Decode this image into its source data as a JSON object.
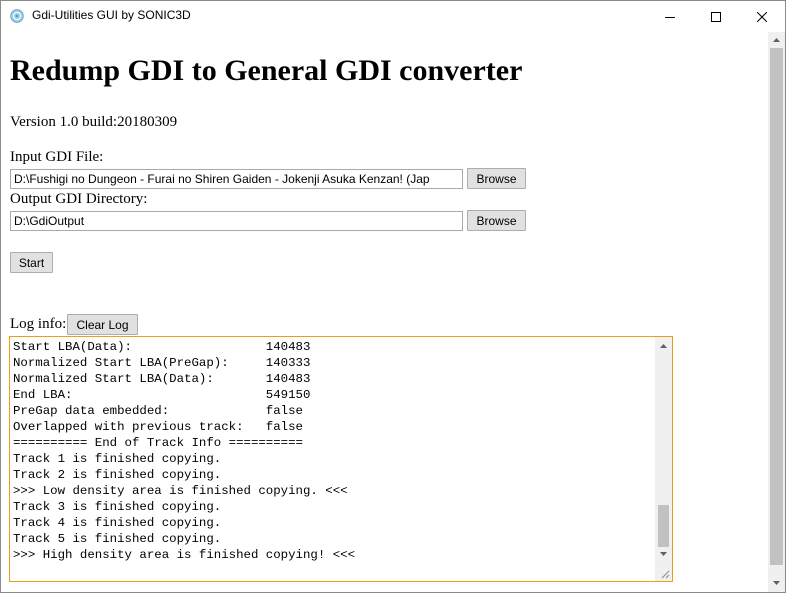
{
  "window": {
    "title": "Gdi-Utilities GUI by SONIC3D"
  },
  "header": {
    "title": "Redump GDI to General GDI converter",
    "version": "Version 1.0 build:20180309"
  },
  "form": {
    "input_label": "Input GDI File:",
    "input_value": "D:\\Fushigi no Dungeon - Furai no Shiren Gaiden - Jokenji Asuka Kenzan! (Jap",
    "browse_label": "Browse",
    "output_label": "Output GDI Directory:",
    "output_value": "D:\\GdiOutput",
    "start_label": "Start"
  },
  "log": {
    "label": "Log info:",
    "clear_label": "Clear Log",
    "lines": [
      "Start LBA(Data):                  140483",
      "Normalized Start LBA(PreGap):     140333",
      "Normalized Start LBA(Data):       140483",
      "End LBA:                          549150",
      "PreGap data embedded:             false",
      "Overlapped with previous track:   false",
      "========== End of Track Info ==========",
      "Track 1 is finished copying.",
      "Track 2 is finished copying.",
      ">>> Low density area is finished copying. <<<",
      "Track 3 is finished copying.",
      "Track 4 is finished copying.",
      "Track 5 is finished copying.",
      ">>> High density area is finished copying! <<<"
    ]
  },
  "icons": {
    "app": "app-disc-icon",
    "minimize": "minimize-icon",
    "maximize": "maximize-icon",
    "close": "close-icon"
  },
  "colors": {
    "focus_border": "#e3a21a",
    "button_bg": "#e1e1e1",
    "scroll_thumb": "#c1c1c1"
  }
}
